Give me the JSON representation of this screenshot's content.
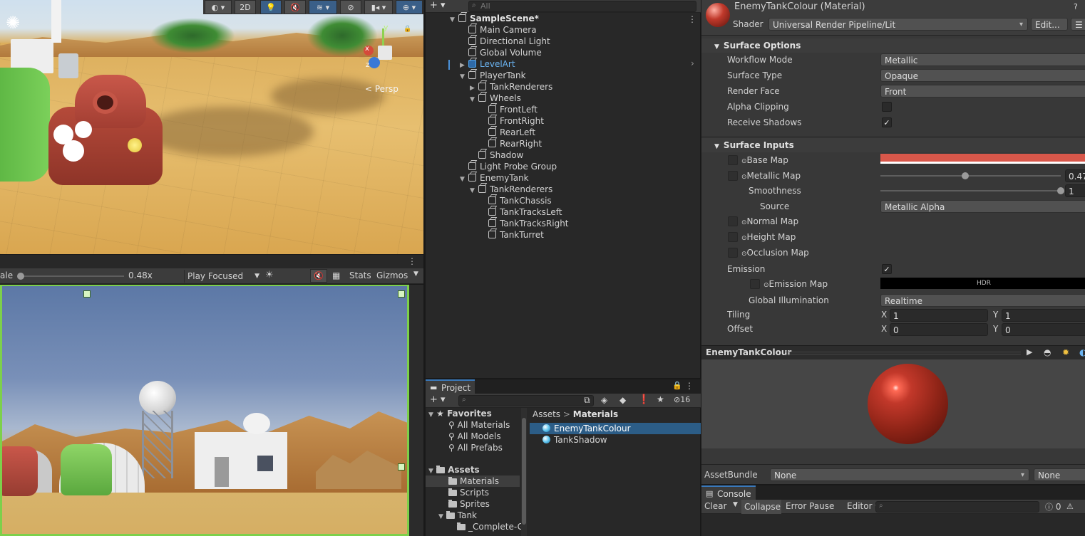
{
  "scene_view": {
    "toolbar": {
      "mode_2d": "2D"
    },
    "gizmo": {
      "axis_y": "y",
      "axis_x": "x",
      "axis_z": "z",
      "projection": "< Persp"
    }
  },
  "game_view": {
    "scale_label": "ale",
    "scale_value": "0.48x",
    "play_mode": "Play Focused",
    "stats": "Stats",
    "gizmos": "Gizmos"
  },
  "hierarchy": {
    "search_placeholder": "All",
    "items": [
      {
        "label": "SampleScene*",
        "indent": 0,
        "arrow": "▼",
        "kind": "scene"
      },
      {
        "label": "Main Camera",
        "indent": 1,
        "arrow": "",
        "kind": "go"
      },
      {
        "label": "Directional Light",
        "indent": 1,
        "arrow": "",
        "kind": "go"
      },
      {
        "label": "Global Volume",
        "indent": 1,
        "arrow": "",
        "kind": "go"
      },
      {
        "label": "LevelArt",
        "indent": 1,
        "arrow": "▶",
        "kind": "prefab"
      },
      {
        "label": "PlayerTank",
        "indent": 1,
        "arrow": "▼",
        "kind": "go"
      },
      {
        "label": "TankRenderers",
        "indent": 2,
        "arrow": "▶",
        "kind": "go"
      },
      {
        "label": "Wheels",
        "indent": 2,
        "arrow": "▼",
        "kind": "go"
      },
      {
        "label": "FrontLeft",
        "indent": 3,
        "arrow": "",
        "kind": "go"
      },
      {
        "label": "FrontRight",
        "indent": 3,
        "arrow": "",
        "kind": "go"
      },
      {
        "label": "RearLeft",
        "indent": 3,
        "arrow": "",
        "kind": "go"
      },
      {
        "label": "RearRight",
        "indent": 3,
        "arrow": "",
        "kind": "go"
      },
      {
        "label": "Shadow",
        "indent": 2,
        "arrow": "",
        "kind": "go"
      },
      {
        "label": "Light Probe Group",
        "indent": 1,
        "arrow": "",
        "kind": "go"
      },
      {
        "label": "EnemyTank",
        "indent": 1,
        "arrow": "▼",
        "kind": "go"
      },
      {
        "label": "TankRenderers",
        "indent": 2,
        "arrow": "▼",
        "kind": "go"
      },
      {
        "label": "TankChassis",
        "indent": 3,
        "arrow": "",
        "kind": "go"
      },
      {
        "label": "TankTracksLeft",
        "indent": 3,
        "arrow": "",
        "kind": "go"
      },
      {
        "label": "TankTracksRight",
        "indent": 3,
        "arrow": "",
        "kind": "go"
      },
      {
        "label": "TankTurret",
        "indent": 3,
        "arrow": "",
        "kind": "go"
      }
    ]
  },
  "project": {
    "tab": "Project",
    "hidden_count": "16",
    "favorites": {
      "label": "Favorites",
      "items": [
        "All Materials",
        "All Models",
        "All Prefabs"
      ]
    },
    "assets": {
      "label": "Assets",
      "folders": [
        "Materials",
        "Scripts",
        "Sprites",
        "Tank",
        "_Complete-G"
      ]
    },
    "breadcrumb": {
      "root": "Assets",
      "sep": ">",
      "current": "Materials"
    },
    "files": [
      "EnemyTankColour",
      "TankShadow"
    ]
  },
  "inspector": {
    "title": "EnemyTankColour (Material)",
    "shader_label": "Shader",
    "shader_value": "Universal Render Pipeline/Lit",
    "edit_button": "Edit...",
    "surface_options": {
      "header": "Surface Options",
      "rows": [
        {
          "label": "Workflow Mode",
          "value": "Metallic"
        },
        {
          "label": "Surface Type",
          "value": "Opaque"
        },
        {
          "label": "Render Face",
          "value": "Front"
        }
      ],
      "alpha_clipping": "Alpha Clipping",
      "receive_shadows": "Receive Shadows"
    },
    "surface_inputs": {
      "header": "Surface Inputs",
      "base_map": "Base Map",
      "base_color": "#d8574a",
      "metallic_map": "Metallic Map",
      "metallic_value": "0.47",
      "metallic_fraction": 0.47,
      "smoothness": "Smoothness",
      "smoothness_value": "1",
      "smoothness_fraction": 1.0,
      "source_label": "Source",
      "source_value": "Metallic Alpha",
      "normal_map": "Normal Map",
      "height_map": "Height Map",
      "occlusion_map": "Occlusion Map",
      "emission": "Emission",
      "emission_map": "Emission Map",
      "hdr": "HDR",
      "global_illumination": "Global Illumination",
      "gi_value": "Realtime",
      "tiling": "Tiling",
      "offset": "Offset",
      "x": "X",
      "y": "Y",
      "tiling_x": "1",
      "tiling_y": "1",
      "offset_x": "0",
      "offset_y": "0"
    },
    "preview_title": "EnemyTankColour",
    "assetbundle_label": "AssetBundle",
    "assetbundle_value": "None",
    "assetbundle_variant": "None"
  },
  "console": {
    "tab": "Console",
    "clear": "Clear",
    "collapse": "Collapse",
    "error_pause": "Error Pause",
    "editor": "Editor",
    "count": "0"
  }
}
